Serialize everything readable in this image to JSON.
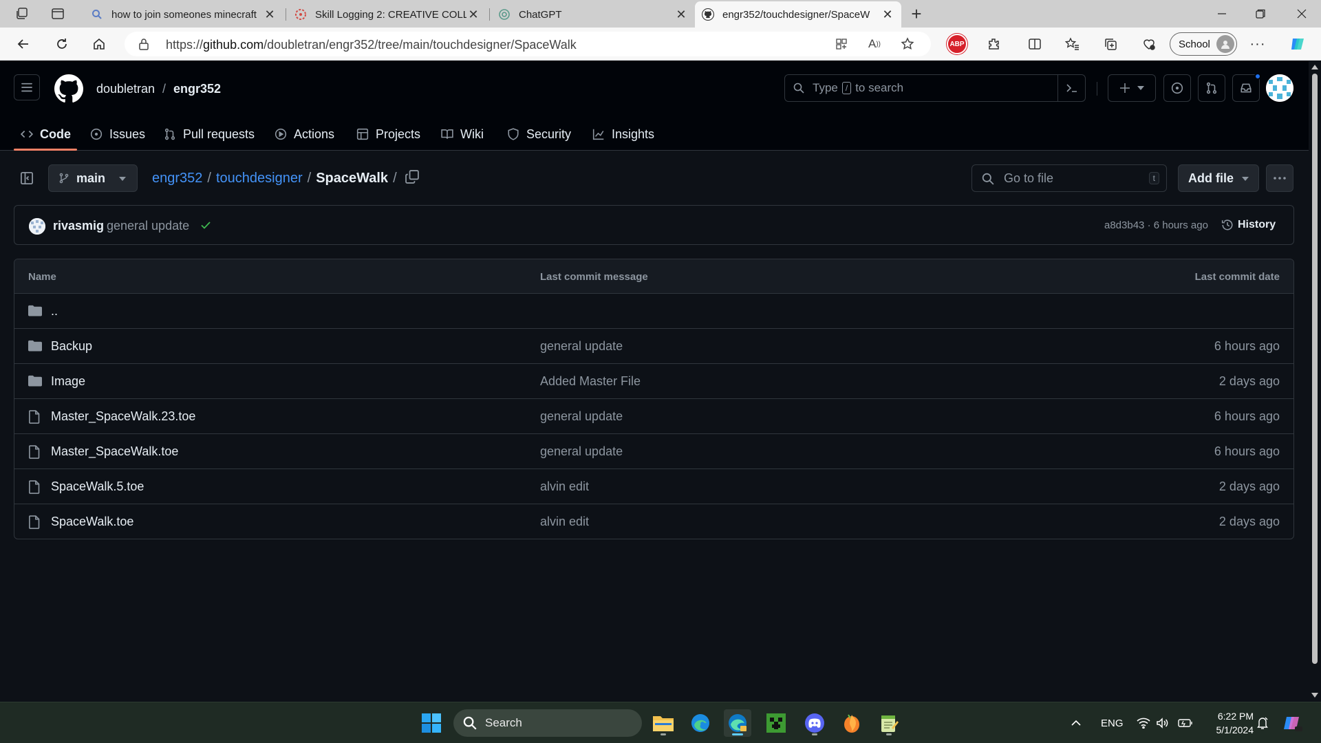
{
  "browser": {
    "tabs": [
      {
        "title": "how to join someones minecraft",
        "active": false
      },
      {
        "title": "Skill Logging 2: CREATIVE COLLA",
        "active": false
      },
      {
        "title": "ChatGPT",
        "active": false
      },
      {
        "title": "engr352/touchdesigner/SpaceW",
        "active": true
      }
    ],
    "url_prefix": "https://",
    "url_host": "github.com",
    "url_path": "/doubletran/engr352/tree/main/touchdesigner/SpaceWalk",
    "abp_label": "ABP",
    "profile_label": "School"
  },
  "header": {
    "owner": "doubletran",
    "separator": "/",
    "repo": "engr352",
    "search_pre": "Type",
    "search_key": "/",
    "search_post": "to search"
  },
  "repo_nav": [
    {
      "label": "Code",
      "icon": "code-icon"
    },
    {
      "label": "Issues",
      "icon": "issue-icon"
    },
    {
      "label": "Pull requests",
      "icon": "pull-request-icon"
    },
    {
      "label": "Actions",
      "icon": "play-icon"
    },
    {
      "label": "Projects",
      "icon": "table-icon"
    },
    {
      "label": "Wiki",
      "icon": "book-icon"
    },
    {
      "label": "Security",
      "icon": "shield-icon"
    },
    {
      "label": "Insights",
      "icon": "graph-icon"
    }
  ],
  "branch": "main",
  "path": {
    "segments": [
      "engr352",
      "touchdesigner"
    ],
    "current": "SpaceWalk",
    "sep": "/"
  },
  "goto_placeholder": "Go to file",
  "goto_key": "t",
  "add_file_label": "Add file",
  "commit": {
    "author": "rivasmig",
    "message": "general update",
    "meta": "a8d3b43 · 6 hours ago",
    "history_label": "History"
  },
  "table": {
    "headers": {
      "name": "Name",
      "message": "Last commit message",
      "date": "Last commit date"
    },
    "parent": "..",
    "rows": [
      {
        "type": "folder",
        "name": "Backup",
        "message": "general update",
        "date": "6 hours ago"
      },
      {
        "type": "folder",
        "name": "Image",
        "message": "Added Master File",
        "date": "2 days ago"
      },
      {
        "type": "file",
        "name": "Master_SpaceWalk.23.toe",
        "message": "general update",
        "date": "6 hours ago"
      },
      {
        "type": "file",
        "name": "Master_SpaceWalk.toe",
        "message": "general update",
        "date": "6 hours ago"
      },
      {
        "type": "file",
        "name": "SpaceWalk.5.toe",
        "message": "alvin edit",
        "date": "2 days ago"
      },
      {
        "type": "file",
        "name": "SpaceWalk.toe",
        "message": "alvin edit",
        "date": "2 days ago"
      }
    ]
  },
  "taskbar": {
    "search_label": "Search",
    "lang": "ENG",
    "time": "6:22 PM",
    "date": "5/1/2024"
  },
  "colors": {
    "accent_link": "#4493f8",
    "active_tab_underline": "#f78166",
    "success": "#3fb950",
    "page_bg": "#0d1117"
  }
}
